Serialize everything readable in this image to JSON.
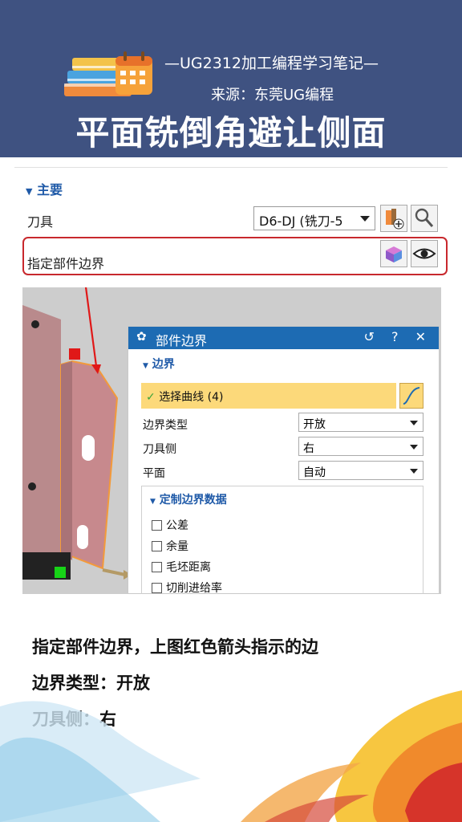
{
  "header": {
    "subtitle_1": "—UG2312加工编程学习笔记—",
    "subtitle_2": "来源：东莞UG编程",
    "title": "平面铣倒角避让侧面"
  },
  "panel": {
    "section_label": "主要",
    "tool_label": "刀具",
    "tool_value": "D6-DJ (铣刀-5",
    "boundary_label": "指定部件边界"
  },
  "dialog": {
    "title": "部件边界",
    "controls": "↺ ? ✕",
    "section": "边界",
    "select_curve": "选择曲线 (4)",
    "rows": [
      {
        "label": "边界类型",
        "value": "开放"
      },
      {
        "label": "刀具侧",
        "value": "右"
      },
      {
        "label": "平面",
        "value": "自动"
      }
    ],
    "custom_section": "定制边界数据",
    "checkboxes": [
      "公差",
      "余量",
      "毛坯距离",
      "切削进给率"
    ]
  },
  "notes": [
    "指定部件边界，上图红色箭头指示的边",
    "边界类型：开放",
    "刀具侧：右"
  ],
  "colors": {
    "header_bg": "#3f5281",
    "accent_blue": "#1d6bb3",
    "highlight_red": "#c8282d",
    "selection_yellow": "#fcd97a"
  }
}
